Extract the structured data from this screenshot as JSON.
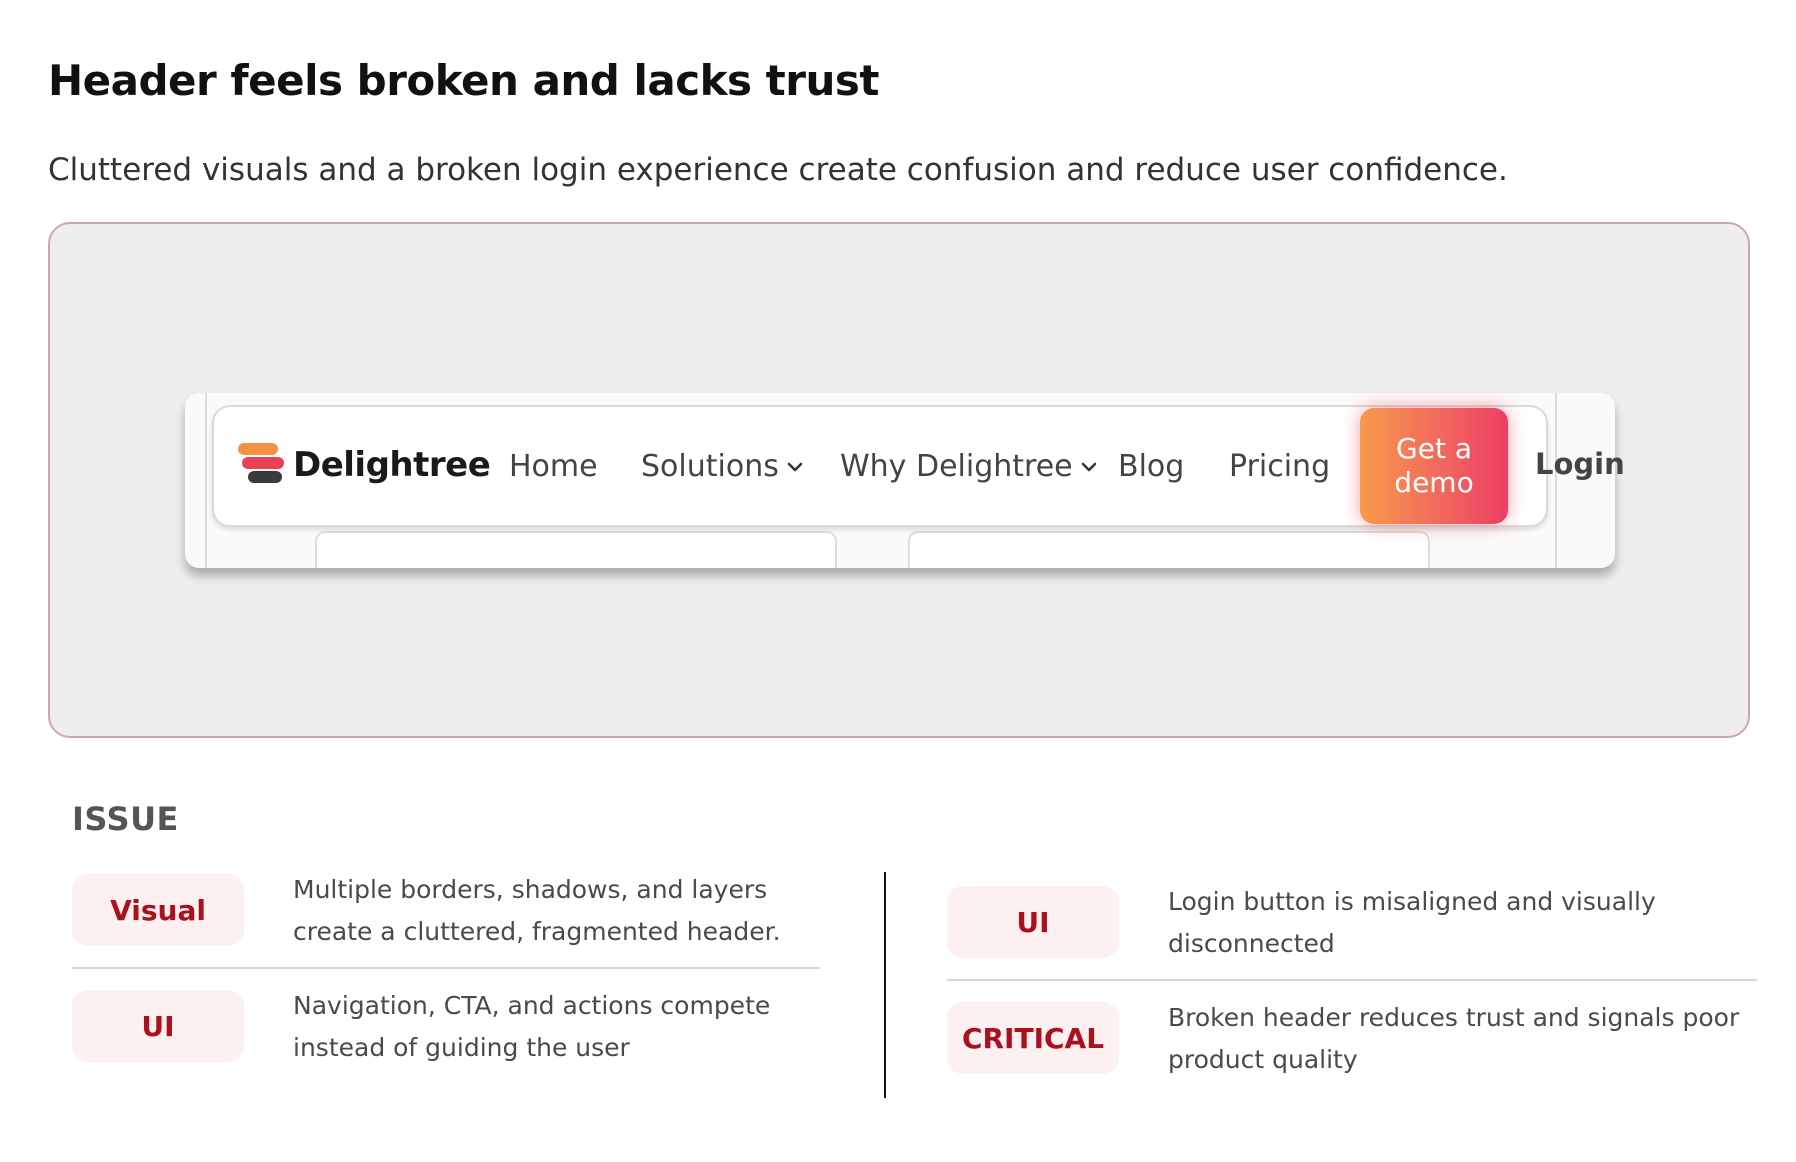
{
  "header": {
    "title": "Header feels broken and lacks trust",
    "subtitle": "Cluttered visuals and a broken login experience create confusion and reduce user confidence."
  },
  "mockup": {
    "logo_text": "Delightree",
    "nav": [
      {
        "label": "Home"
      },
      {
        "label": "Solutions"
      },
      {
        "label": "Why Delightree"
      },
      {
        "label": "Blog"
      },
      {
        "label": "Pricing"
      }
    ],
    "cta_label": "Get a demo",
    "login_label": "Login",
    "colors": {
      "cta_gradient_start": "#f79a4a",
      "cta_gradient_end": "#ec3e63",
      "logo_orange": "#f39145",
      "logo_red": "#e94256",
      "logo_dark": "#3a3a3a"
    }
  },
  "issues": {
    "heading": "ISSUE",
    "left": [
      {
        "tag": "Visual",
        "text": "Multiple borders, shadows, and layers create a cluttered, fragmented header."
      },
      {
        "tag": "UI",
        "text": "Navigation, CTA, and actions compete instead of guiding the user"
      }
    ],
    "right": [
      {
        "tag": "UI",
        "text": "Login button is misaligned and visually disconnected"
      },
      {
        "tag": "CRITICAL",
        "text": "Broken header reduces trust and signals poor product quality"
      }
    ],
    "colors": {
      "badge_bg": "#fdf0f0",
      "badge_text": "#a8111d"
    }
  }
}
